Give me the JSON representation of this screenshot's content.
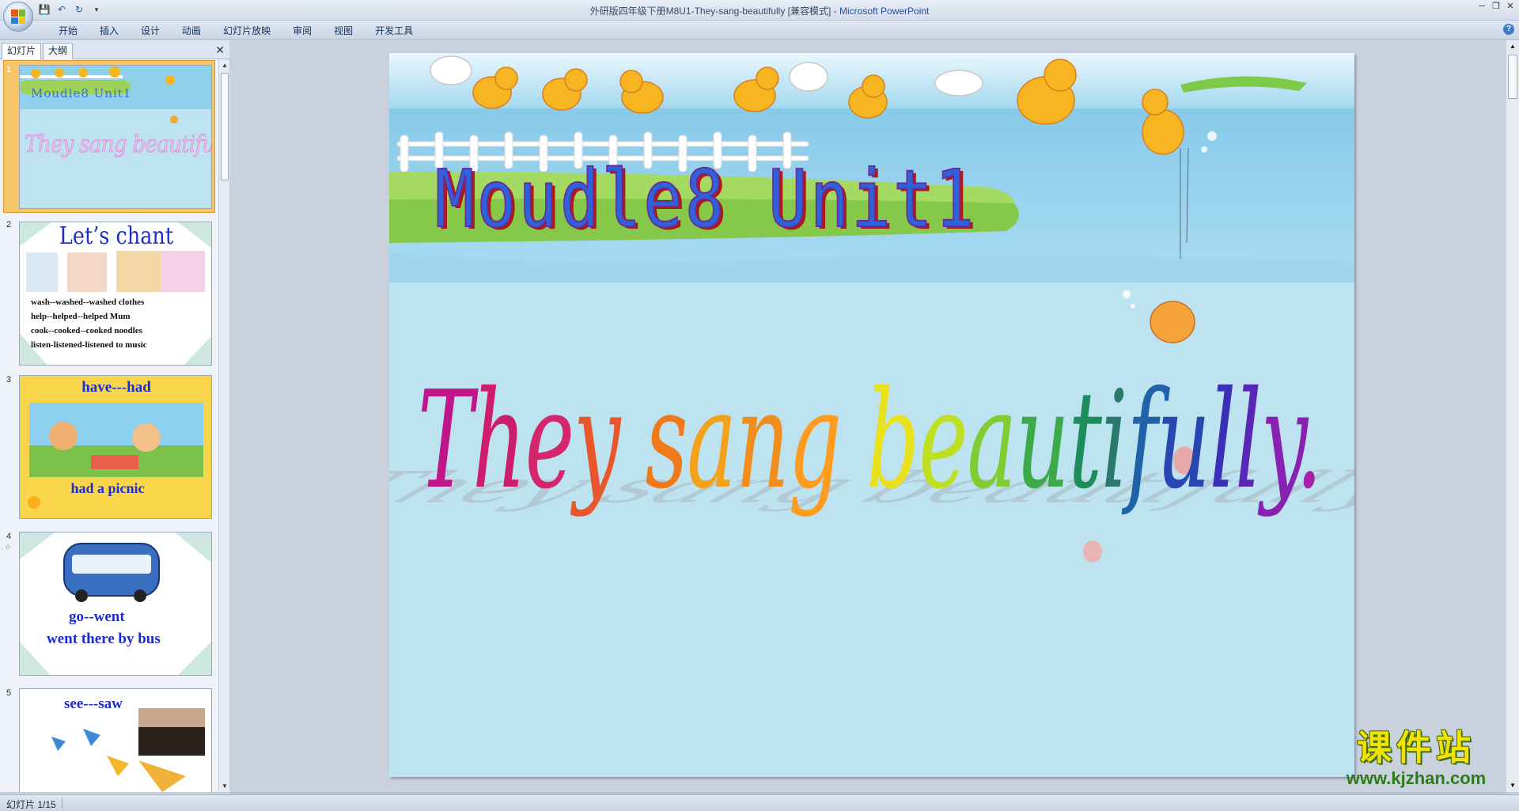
{
  "window": {
    "title_doc": "外研版四年级下册M8U1-They-sang-beautifully [兼容模式]",
    "title_sep": " - ",
    "title_app": "Microsoft PowerPoint",
    "controls": {
      "minimize": "─",
      "restore": "❐",
      "close": "✕"
    }
  },
  "qat": {
    "save_icon": "💾",
    "undo_icon": "↶",
    "redo_icon": "↻",
    "more_icon": "▾"
  },
  "ribbon": {
    "tabs": [
      "开始",
      "插入",
      "设计",
      "动画",
      "幻灯片放映",
      "审阅",
      "视图",
      "开发工具"
    ],
    "help": "?"
  },
  "panel": {
    "tab_slides": "幻灯片",
    "tab_outline": "大纲",
    "close": "✕",
    "scroll_up": "▲",
    "scroll_down": "▼"
  },
  "thumbnails": [
    {
      "num": "1",
      "title": "Moudle8 Unit1",
      "subtitle": "They sang beautifully."
    },
    {
      "num": "2",
      "title": "Let’s chant",
      "lines": [
        "wash--washed--washed  clothes",
        "help--helped--helped  Mum",
        "cook--cooked--cooked noodles",
        "listen-listened-listened  to music"
      ]
    },
    {
      "num": "3",
      "title": "have---had",
      "caption": "had a picnic"
    },
    {
      "num": "4",
      "star": "☆",
      "title": "go--went",
      "caption": "went there by bus"
    },
    {
      "num": "5",
      "title": "see---saw"
    }
  ],
  "slide": {
    "title": "Moudle8 Unit1",
    "subtitle_words": [
      "They",
      "sang",
      "beautifully."
    ],
    "subtitle_colors": [
      "#c0168a",
      "#cf1d6e",
      "#d3266d",
      "#e8572c",
      "#f07a1a",
      "#f4a21b",
      "#f08d1c",
      "#ff9c1f",
      "#e8e11b",
      "#bfe022",
      "#80cc32",
      "#3da94a",
      "#1f8c5c",
      "#2a7a6c",
      "#1f62a8",
      "#2947b2",
      "#3a30b8",
      "#5a26b5",
      "#8820b0",
      "#a81fa8"
    ]
  },
  "status": {
    "text": "幻灯片 1/15"
  },
  "watermark": {
    "cn": "课件站",
    "url": "www.kjzhan.com"
  }
}
